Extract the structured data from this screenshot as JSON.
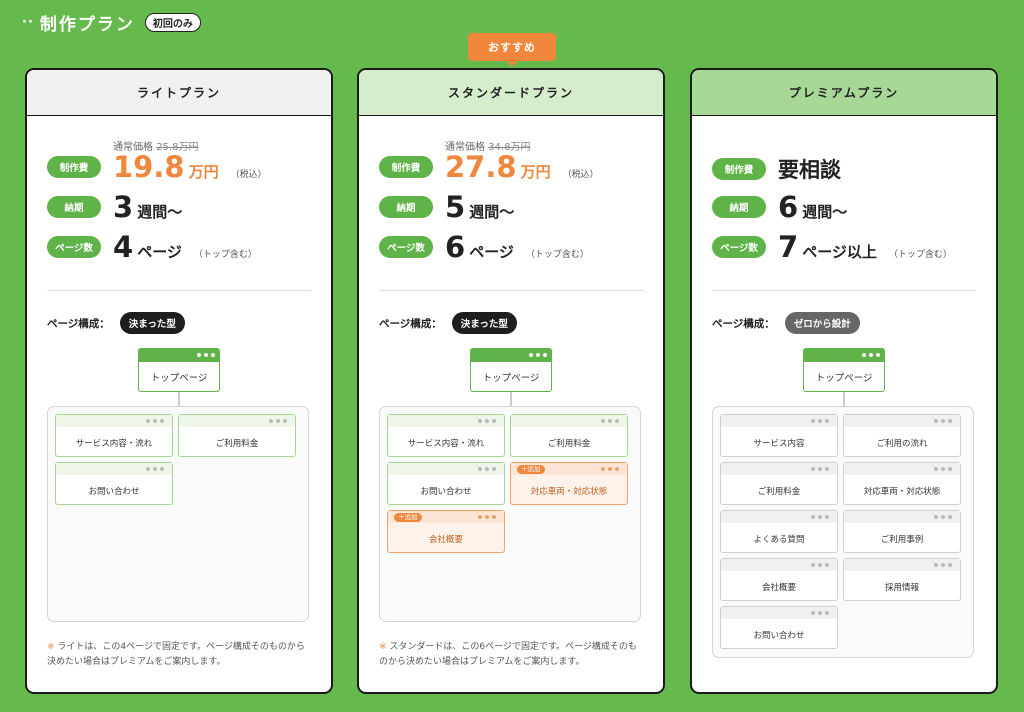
{
  "header": {
    "dots": "··",
    "title": "制作プラン",
    "badge": "初回のみ"
  },
  "recommend_label": "おすすめ",
  "labels": {
    "cost": "制作費",
    "period": "納期",
    "pages": "ページ数",
    "structure": "ページ構成：",
    "added": "＋追加"
  },
  "plans": {
    "lite": {
      "name": "ライトプラン",
      "regular_price": "通常価格",
      "regular_value": "25.8万円",
      "price": "19.8",
      "price_unit": "万円",
      "tax": "（税込）",
      "period_num": "3",
      "period_unit": "週間〜",
      "pages_num": "4",
      "pages_unit": "ページ",
      "pages_note": "（トップ含む）",
      "structure_type": "決まった型",
      "top_page": "トップページ",
      "pages": [
        "サービス内容・流れ",
        "ご利用料金",
        "お問い合わせ"
      ],
      "footnote_mark": "※",
      "footnote": "ライトは、この4ページで固定です。ページ構成そのものから決めたい場合はプレミアムをご案内します。"
    },
    "standard": {
      "name": "スタンダードプラン",
      "regular_price": "通常価格",
      "regular_value": "34.8万円",
      "price": "27.8",
      "price_unit": "万円",
      "tax": "（税込）",
      "period_num": "5",
      "period_unit": "週間〜",
      "pages_num": "6",
      "pages_unit": "ページ",
      "pages_note": "（トップ含む）",
      "structure_type": "決まった型",
      "top_page": "トップページ",
      "pages": [
        "サービス内容・流れ",
        "ご利用料金",
        "お問い合わせ",
        "対応車両・対応状態",
        "会社概要"
      ],
      "footnote_mark": "※",
      "footnote": "スタンダードは、この6ページで固定です。ページ構成そのものから決めたい場合はプレミアムをご案内します。"
    },
    "premium": {
      "name": "プレミアムプラン",
      "price_text": "要相談",
      "period_num": "6",
      "period_unit": "週間〜",
      "pages_num": "7",
      "pages_unit": "ページ以上",
      "pages_note": "（トップ含む）",
      "structure_type": "ゼロから設計",
      "top_page": "トップページ",
      "pages": [
        "サービス内容",
        "ご利用の流れ",
        "ご利用料金",
        "対応車両・対応状態",
        "よくある質問",
        "ご利用事例",
        "会社概要",
        "採用情報",
        "お問い合わせ"
      ]
    }
  }
}
